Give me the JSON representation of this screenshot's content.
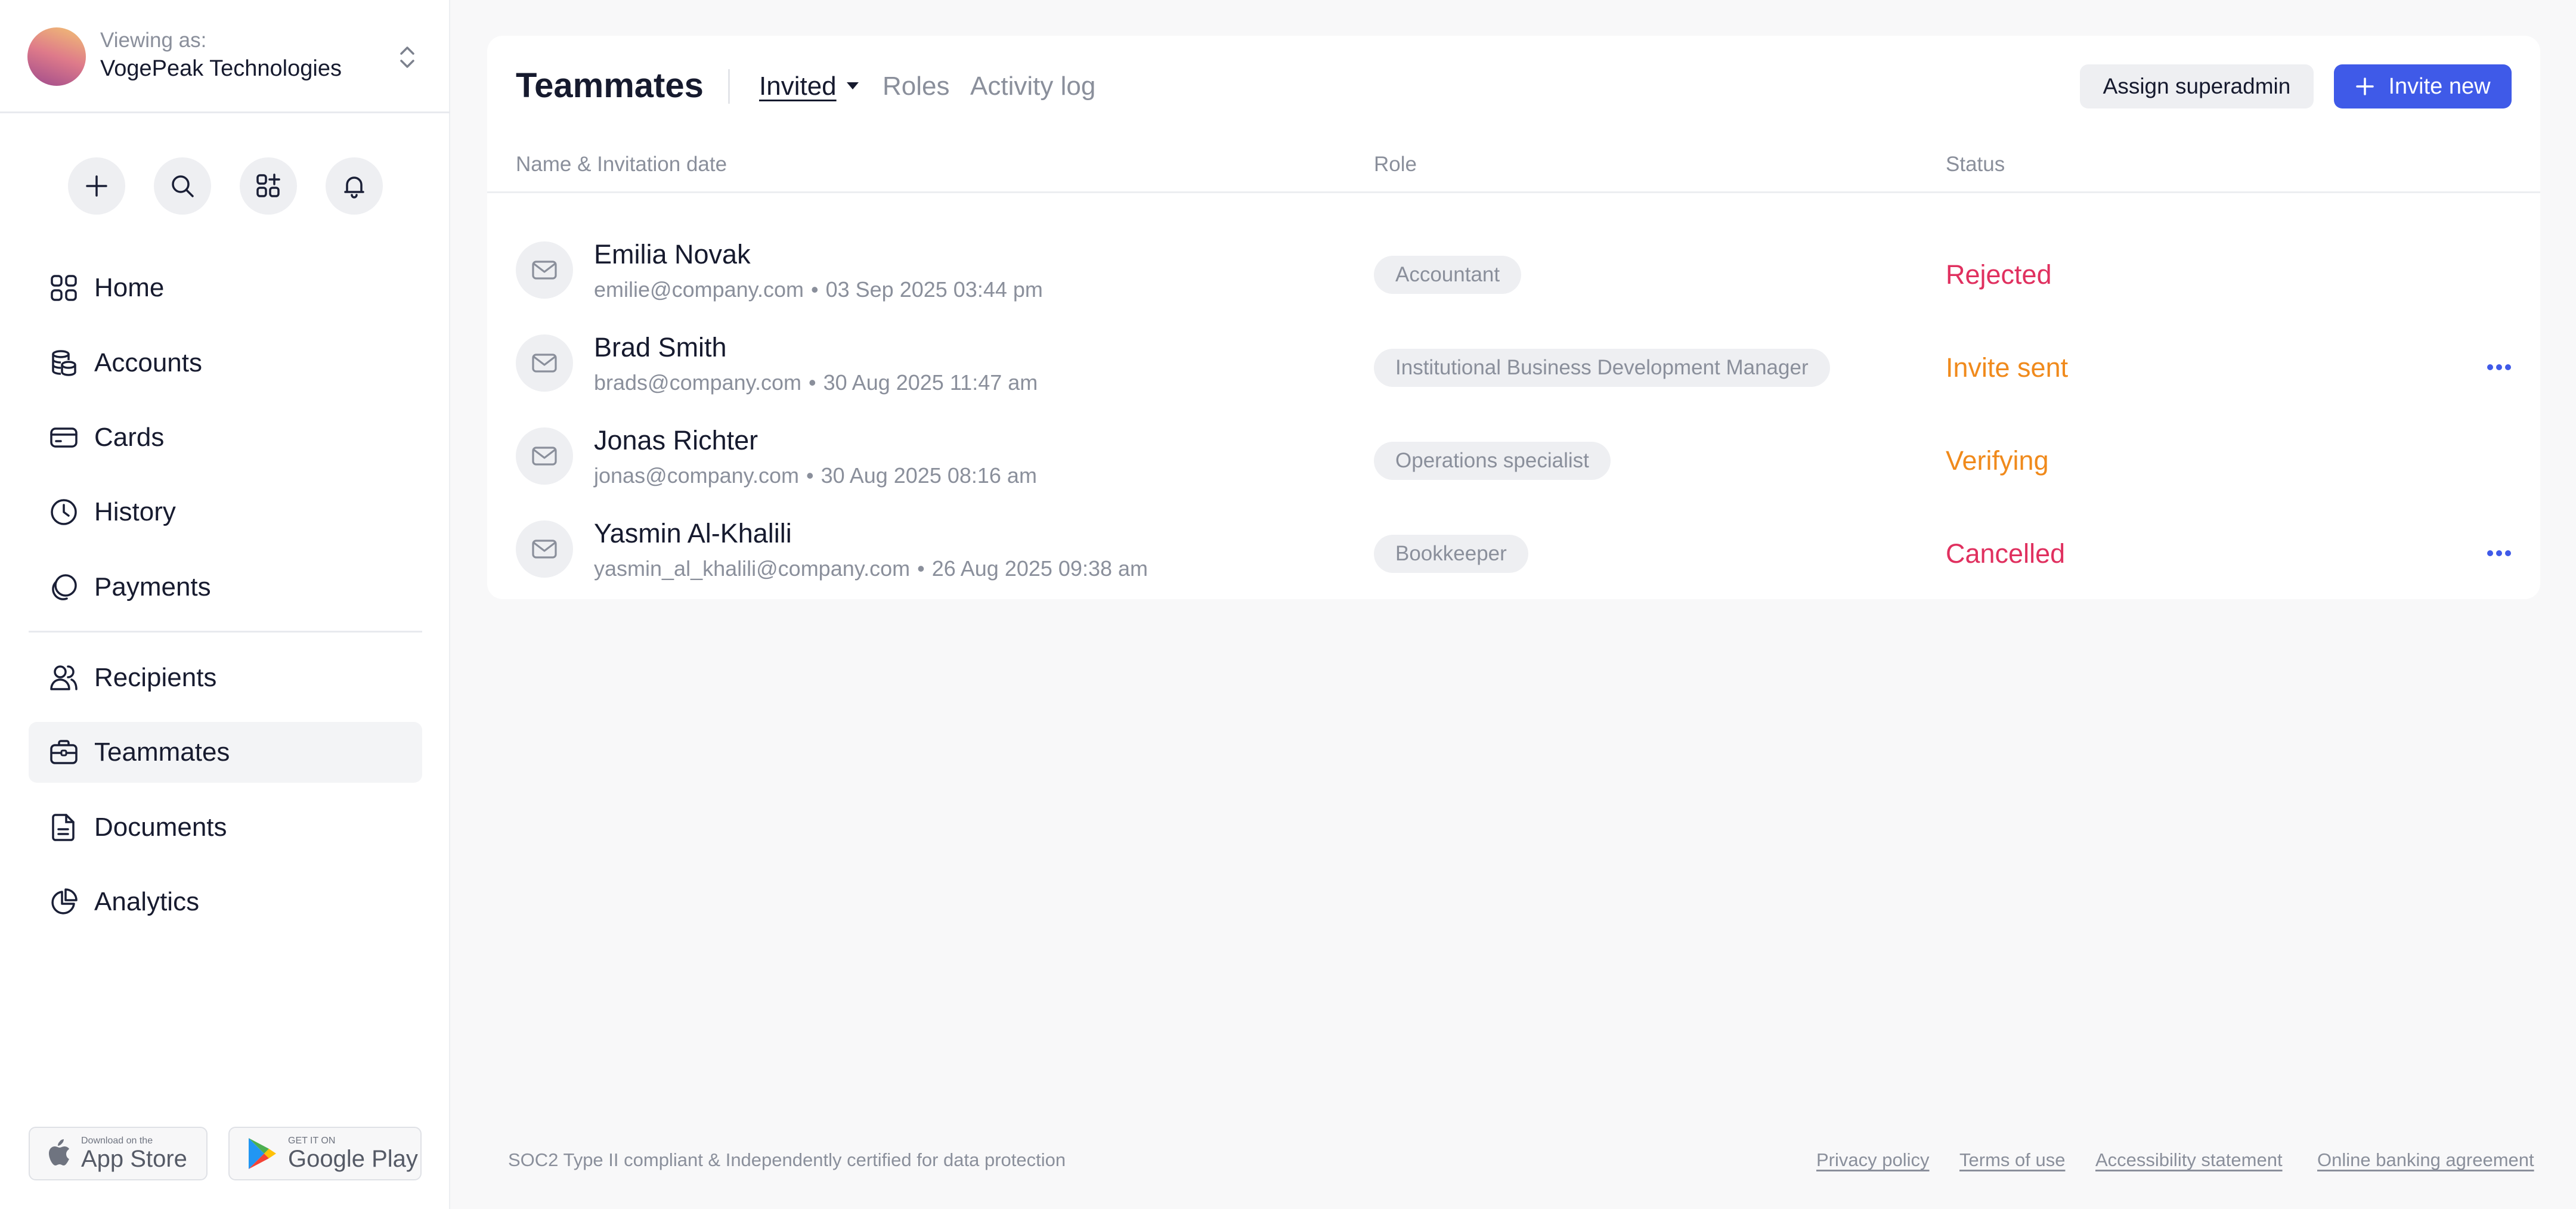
{
  "account": {
    "viewing_label": "Viewing as:",
    "org_name": "VogePeak Technologies"
  },
  "quick_actions": [
    "plus-icon",
    "search-icon",
    "apps-add-icon",
    "bell-icon"
  ],
  "nav": {
    "items": [
      {
        "label": "Home",
        "icon": "grid-icon"
      },
      {
        "label": "Accounts",
        "icon": "coins-icon"
      },
      {
        "label": "Cards",
        "icon": "card-icon"
      },
      {
        "label": "History",
        "icon": "clock-icon"
      },
      {
        "label": "Payments",
        "icon": "payments-icon"
      },
      {
        "label": "Recipients",
        "icon": "users-icon"
      },
      {
        "label": "Teammates",
        "icon": "briefcase-icon",
        "active": true
      },
      {
        "label": "Documents",
        "icon": "document-icon"
      },
      {
        "label": "Analytics",
        "icon": "pie-chart-icon"
      }
    ]
  },
  "stores": {
    "apple_small": "Download on the",
    "apple_big": "App Store",
    "google_small": "GET IT ON",
    "google_big": "Google Play"
  },
  "page": {
    "title": "Teammates",
    "tabs": [
      {
        "label": "Invited",
        "active": true
      },
      {
        "label": "Roles"
      },
      {
        "label": "Activity log"
      }
    ],
    "assign_button": "Assign superadmin",
    "invite_button": "Invite new"
  },
  "table": {
    "columns": [
      "Name & Invitation date",
      "Role",
      "Status"
    ],
    "rows": [
      {
        "name": "Emilia Novak",
        "email": "emilie@company.com",
        "date": "03 Sep 2025 03:44 pm",
        "role": "Accountant",
        "status": "Rejected",
        "status_color": "#e0305f",
        "more": false
      },
      {
        "name": "Brad Smith",
        "email": "brads@company.com",
        "date": "30 Aug 2025 11:47 am",
        "role": "Institutional Business Development Manager",
        "status": "Invite sent",
        "status_color": "#f08a1c",
        "more": true
      },
      {
        "name": "Jonas Richter",
        "email": "jonas@company.com",
        "date": "30 Aug 2025 08:16 am",
        "role": "Operations specialist",
        "status": "Verifying",
        "status_color": "#f08a1c",
        "more": false
      },
      {
        "name": "Yasmin Al-Khalili",
        "email": "yasmin_al_khalili@company.com",
        "date": "26 Aug 2025 09:38 am",
        "role": "Bookkeeper",
        "status": "Cancelled",
        "status_color": "#e0305f",
        "more": true
      }
    ]
  },
  "footer": {
    "compliance": "SOC2 Type II compliant & Independently certified for data protection",
    "links": [
      "Privacy policy",
      "Terms of use",
      "Accessibility statement",
      "Online banking agreement"
    ]
  },
  "colors": {
    "accent": "#3f5ae8",
    "rejected": "#e0305f",
    "pending": "#f08a1c"
  }
}
